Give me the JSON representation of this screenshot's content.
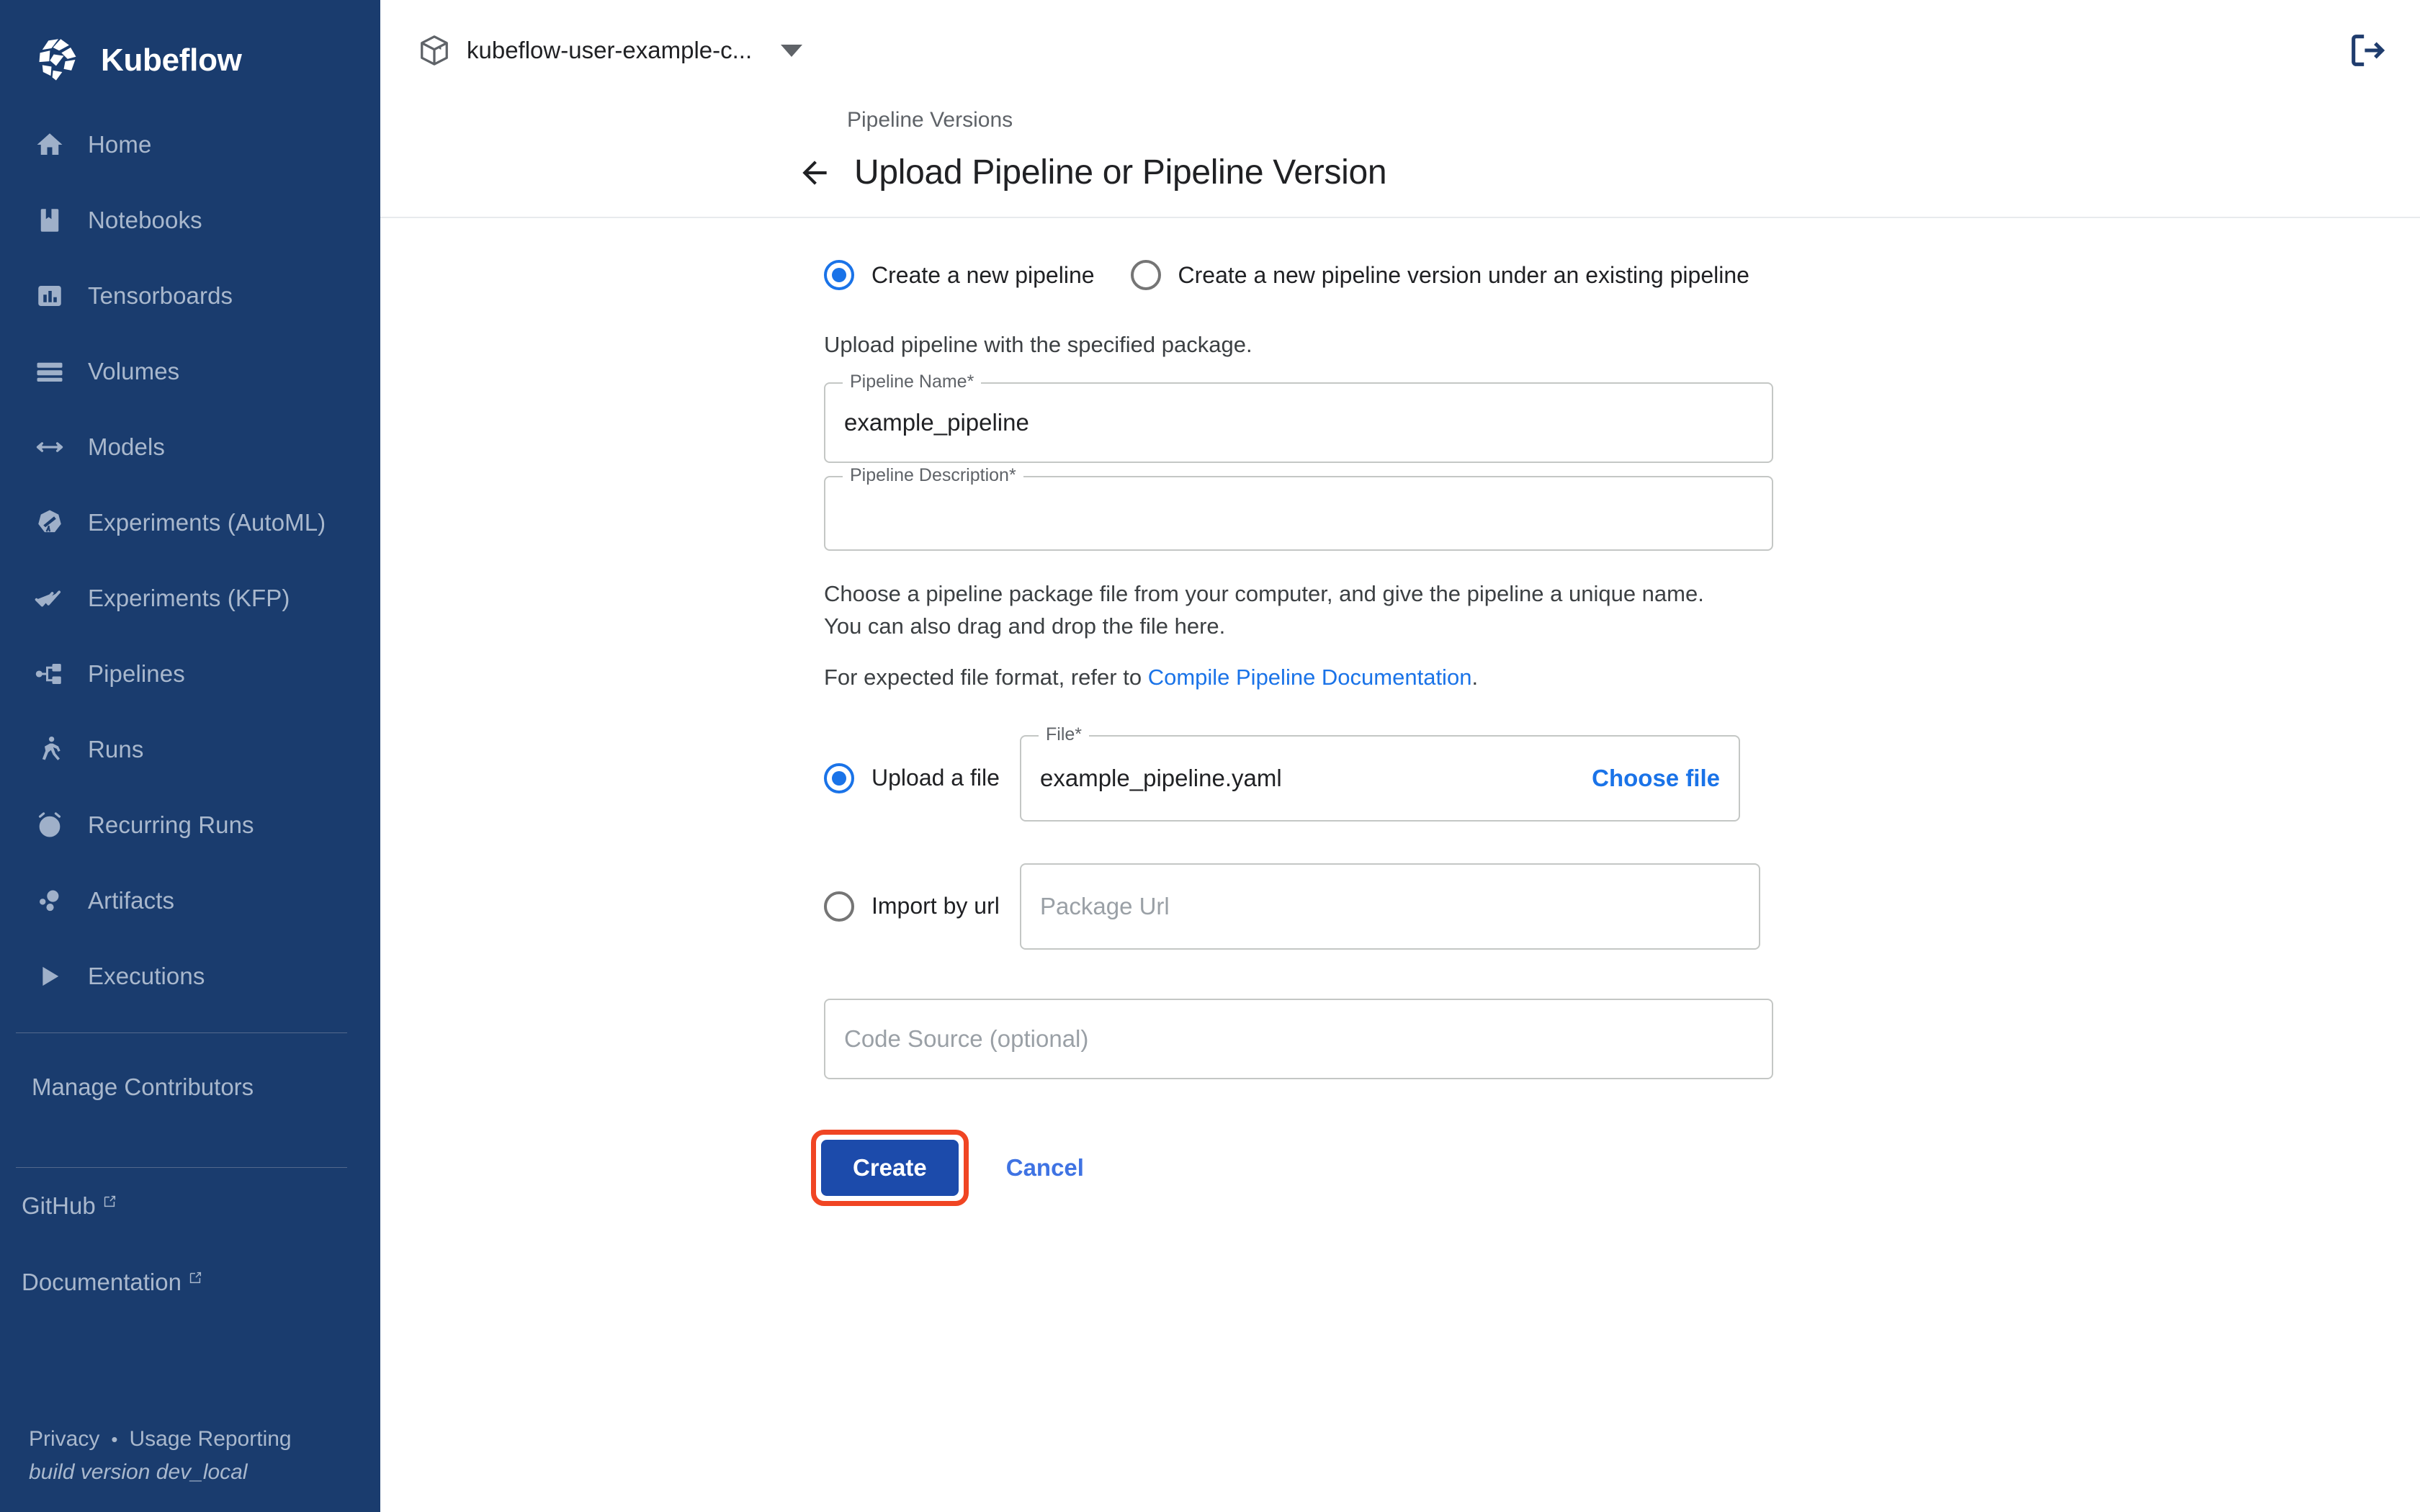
{
  "brand": {
    "name": "Kubeflow",
    "logo_icon": "kubeflow-logo"
  },
  "sidebar": {
    "items": [
      {
        "label": "Home",
        "icon": "home-icon"
      },
      {
        "label": "Notebooks",
        "icon": "notebook-icon"
      },
      {
        "label": "Tensorboards",
        "icon": "bar-chart-icon"
      },
      {
        "label": "Volumes",
        "icon": "storage-icon"
      },
      {
        "label": "Models",
        "icon": "code-arrows-icon"
      },
      {
        "label": "Experiments (AutoML)",
        "icon": "telescope-icon"
      },
      {
        "label": "Experiments (KFP)",
        "icon": "double-check-icon"
      },
      {
        "label": "Pipelines",
        "icon": "pipeline-icon"
      },
      {
        "label": "Runs",
        "icon": "runner-icon"
      },
      {
        "label": "Recurring Runs",
        "icon": "alarm-clock-icon"
      },
      {
        "label": "Artifacts",
        "icon": "bubbles-icon"
      },
      {
        "label": "Executions",
        "icon": "play-triangle-icon"
      }
    ],
    "manage_contributors": "Manage Contributors",
    "external_links": [
      {
        "label": "GitHub",
        "icon": "external-link-icon"
      },
      {
        "label": "Documentation",
        "icon": "external-link-icon"
      }
    ],
    "footer": {
      "privacy": "Privacy",
      "separator": "•",
      "usage_reporting": "Usage Reporting",
      "build_version": "build version dev_local"
    }
  },
  "topbar": {
    "namespace": "kubeflow-user-example-c...",
    "namespace_icon": "package-cube-icon",
    "caret_icon": "chevron-down-icon",
    "logout_icon": "logout-icon"
  },
  "page": {
    "breadcrumb": "Pipeline Versions",
    "back_icon": "arrow-left-icon",
    "title": "Upload Pipeline or Pipeline Version"
  },
  "form": {
    "mode_options": [
      {
        "label": "Create a new pipeline",
        "selected": true
      },
      {
        "label": "Create a new pipeline version under an existing pipeline",
        "selected": false
      }
    ],
    "hint": "Upload pipeline with the specified package.",
    "pipeline_name": {
      "legend": "Pipeline Name*",
      "value": "example_pipeline"
    },
    "pipeline_description": {
      "legend": "Pipeline Description*",
      "value": ""
    },
    "paragraph_line1": "Choose a pipeline package file from your computer, and give the pipeline a unique name.",
    "paragraph_line2": "You can also drag and drop the file here.",
    "format_prefix": "For expected file format, refer to ",
    "format_link": "Compile Pipeline Documentation",
    "format_suffix": ".",
    "source_options": [
      {
        "label": "Upload a file",
        "selected": true
      },
      {
        "label": "Import by url",
        "selected": false
      }
    ],
    "file_field": {
      "legend": "File*",
      "value": "example_pipeline.yaml",
      "choose_label": "Choose file"
    },
    "url_field": {
      "placeholder": "Package Url",
      "value": ""
    },
    "code_source": {
      "placeholder": "Code Source (optional)",
      "value": ""
    },
    "create_label": "Create",
    "cancel_label": "Cancel"
  },
  "colors": {
    "sidebar_bg": "#1a3c6e",
    "accent_blue": "#1a73e8",
    "create_button": "#1c4bab",
    "highlight_ring": "#f04523"
  }
}
